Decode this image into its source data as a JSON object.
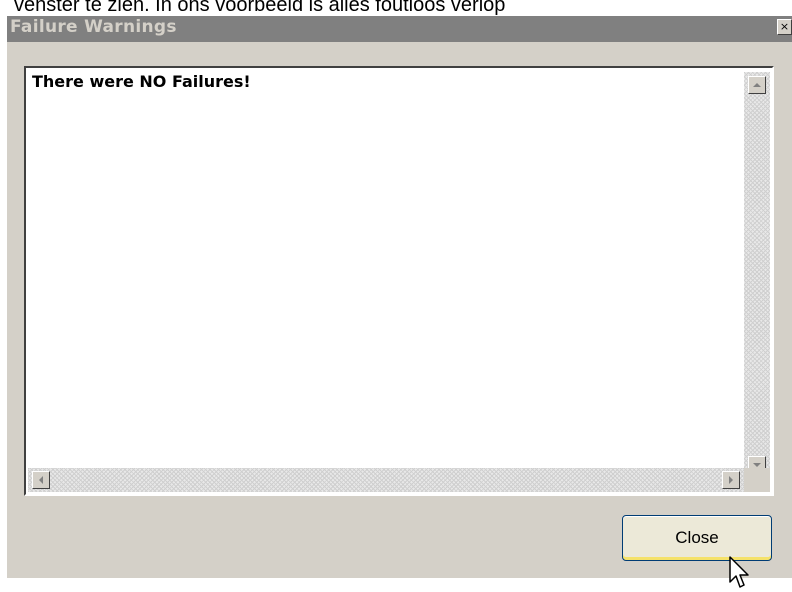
{
  "background_text": "venster te zien. In ons voorbeeld is alles foutloos verlop",
  "window": {
    "title": "Failure Warnings",
    "close_glyph": "×"
  },
  "content": {
    "message": "There were NO Failures!"
  },
  "buttons": {
    "close_label": "Close"
  },
  "icons": {
    "scroll_up": "scroll-up-icon",
    "scroll_down": "scroll-down-icon",
    "scroll_left": "scroll-left-icon",
    "scroll_right": "scroll-right-icon",
    "cursor": "mouse-pointer-icon"
  },
  "colors": {
    "titlebar": "#808080",
    "dialog": "#d4d0c8",
    "button_focus": "#f5e26a"
  }
}
